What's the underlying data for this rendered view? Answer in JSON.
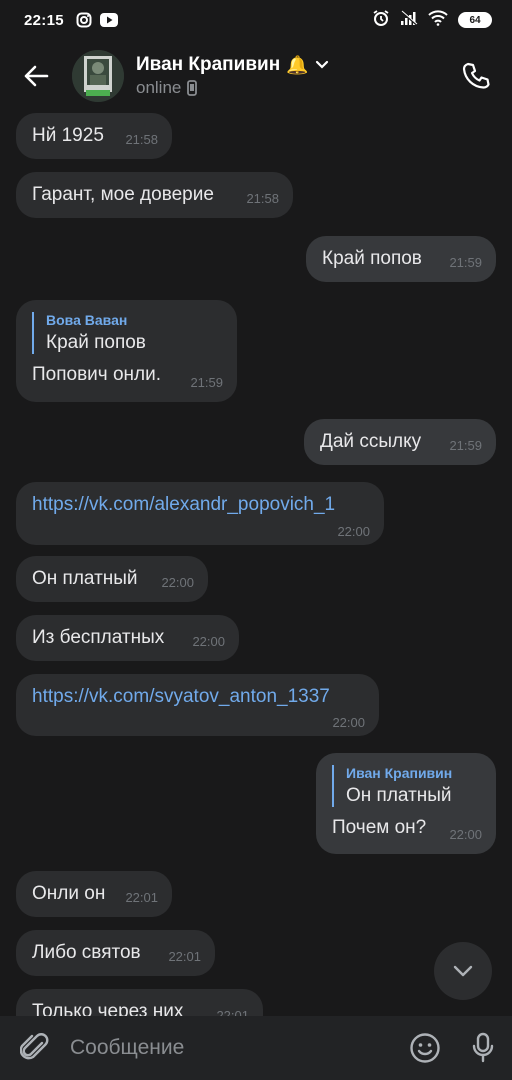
{
  "statusbar": {
    "time": "22:15",
    "battery": "64"
  },
  "header": {
    "name": "Иван Крапивин",
    "name_emoji": "🔔",
    "status": "online"
  },
  "messages": [
    {
      "dir": "in",
      "text": "Нй 1925",
      "time": "21:58"
    },
    {
      "dir": "in",
      "text": "Гарант, мое доверие",
      "time": "21:58"
    },
    {
      "dir": "out",
      "text": "Край попов",
      "time": "21:59"
    },
    {
      "dir": "in",
      "reply_author": "Вова Ваван",
      "reply_text": "Край попов",
      "text": "Попович онли.",
      "time": "21:59"
    },
    {
      "dir": "out",
      "text": "Дай ссылку",
      "time": "21:59"
    },
    {
      "dir": "in",
      "text": "https://vk.com/alexandr_popovich_1",
      "time": "22:00",
      "link": true
    },
    {
      "dir": "in",
      "text": "Он платный",
      "time": "22:00"
    },
    {
      "dir": "in",
      "text": "Из бесплатных",
      "time": "22:00"
    },
    {
      "dir": "in",
      "text": "https://vk.com/svyatov_anton_1337",
      "time": "22:00",
      "link": true
    },
    {
      "dir": "out",
      "reply_author": "Иван Крапивин",
      "reply_text": "Он платный",
      "text": "Почем он?",
      "time": "22:00"
    },
    {
      "dir": "in",
      "text": "Онли он",
      "time": "22:01"
    },
    {
      "dir": "in",
      "text": "Либо святов",
      "time": "22:01"
    },
    {
      "dir": "in",
      "text": "Только через них",
      "time": "22:01"
    }
  ],
  "composer": {
    "placeholder": "Сообщение"
  },
  "colors": {
    "background": "#19191a",
    "bubble_in": "#2c2d2f",
    "bubble_out": "#37393c",
    "accent": "#71aaeb"
  }
}
